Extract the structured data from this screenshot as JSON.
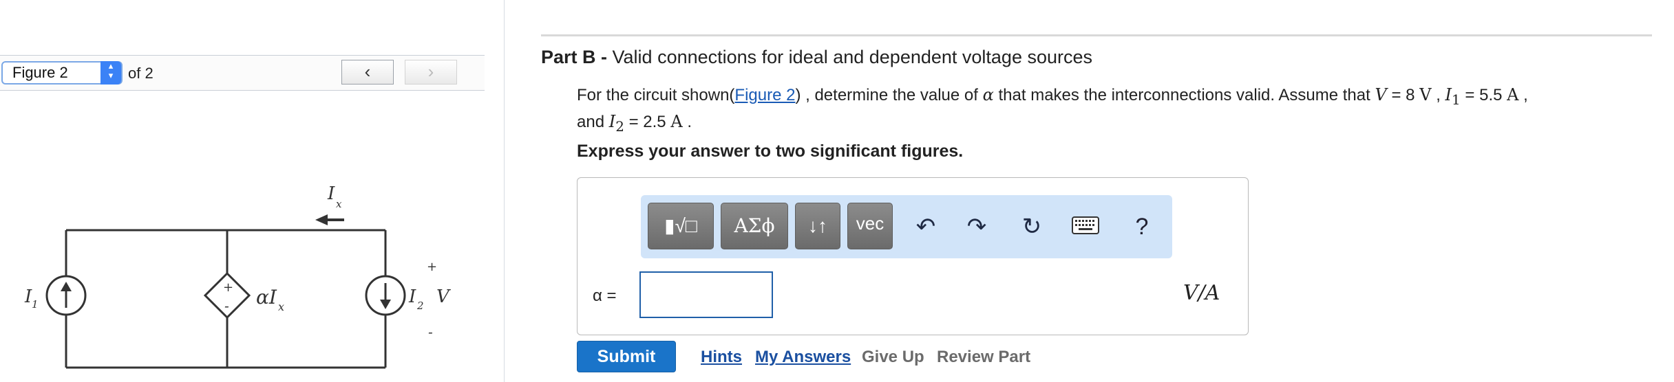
{
  "figure_nav": {
    "selected": "Figure 2",
    "of_label": "of 2",
    "prev_icon": "chevron-left-icon",
    "prev_glyph": "‹",
    "next_icon": "chevron-right-icon",
    "next_glyph": "›"
  },
  "circuit": {
    "current_source_label": "I",
    "current_source_sub": "1",
    "dependent_label": "αI",
    "dependent_sub": "x",
    "ix_label": "I",
    "ix_sub": "x",
    "i2_label": "I",
    "i2_sub": "2",
    "v_label": "V",
    "plus": "+",
    "minus": "-"
  },
  "part": {
    "title_bold": "Part B - ",
    "title_rest": "Valid connections for ideal and dependent voltage sources"
  },
  "question": {
    "prefix": "For the circuit shown(",
    "figure_link": "Figure 2",
    "middle": ") , determine the value of ",
    "alpha": "α",
    "mid2": " that makes the interconnections valid. Assume that ",
    "v_sym": "V",
    "v_val": " = 8 ",
    "v_unit": "V",
    "sep1": " ,  ",
    "i1_sym": "I",
    "i1_sub": "1",
    "i1_val": " = 5.5 ",
    "i1_unit": "A",
    "sep2": " ,",
    "and": "and ",
    "i2_sym": "I",
    "i2_sub": "2",
    "i2_val": " = 2.5 ",
    "i2_unit": "A",
    "end": " ."
  },
  "instruction": "Express your answer to two significant figures.",
  "toolbar": {
    "templates_label": "▮√□",
    "greek_label": "ΑΣϕ",
    "arrows_label": "↓↑",
    "vec_label": "vec",
    "undo_icon": "undo-icon",
    "undo_glyph": "↶",
    "redo_icon": "redo-icon",
    "redo_glyph": "↷",
    "reset_icon": "reset-icon",
    "reset_glyph": "↻",
    "keyboard_icon": "keyboard-icon",
    "help_label": "?"
  },
  "answer": {
    "label": "α =",
    "value": "",
    "units": "V/A"
  },
  "actions": {
    "submit": "Submit",
    "hints": "Hints",
    "my_answers": "My Answers",
    "give_up": "Give Up",
    "review_part": "Review Part"
  },
  "colors": {
    "accent_blue": "#1a74c9",
    "toolbar_bg": "#d1e4f9",
    "link_blue": "#1a4fa0"
  }
}
